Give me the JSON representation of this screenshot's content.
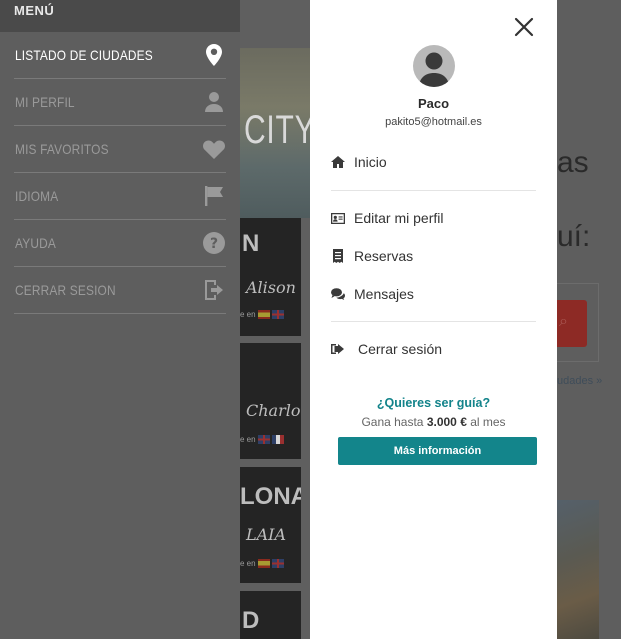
{
  "side_menu": {
    "header": "MENÚ",
    "items": [
      {
        "label": "LISTADO DE CIUDADES",
        "icon": "location-pin-icon",
        "active": true
      },
      {
        "label": "MI PERFIL",
        "icon": "user-icon",
        "active": false
      },
      {
        "label": "MIS FAVORITOS",
        "icon": "heart-icon",
        "active": false
      },
      {
        "label": "IDIOMA",
        "icon": "flag-icon",
        "active": false
      },
      {
        "label": "AYUDA",
        "icon": "help-icon",
        "active": false
      },
      {
        "label": "CERRAR SESION",
        "icon": "logout-icon",
        "active": false
      }
    ]
  },
  "background": {
    "hero_text": "CITY.",
    "cards": [
      {
        "big": "N",
        "script": "Alison",
        "lang_label": "e en"
      },
      {
        "big": "",
        "script": "Charlotte",
        "lang_label": "e en"
      },
      {
        "big": "LONA",
        "script": "LAIA",
        "lang_label": "e en"
      },
      {
        "big": "D",
        "script": "",
        "lang_label": ""
      }
    ],
    "right_texts": [
      "as",
      "uí:"
    ],
    "right_link": "udades »"
  },
  "drawer": {
    "close_icon": "close-icon",
    "user": {
      "name": "Paco",
      "email": "pakito5@hotmail.es",
      "avatar": "avatar-icon"
    },
    "nav_primary": [
      {
        "label": "Inicio",
        "icon": "home-icon"
      }
    ],
    "nav_secondary": [
      {
        "label": "Editar mi perfil",
        "icon": "id-card-icon"
      },
      {
        "label": "Reservas",
        "icon": "receipt-icon"
      },
      {
        "label": "Mensajes",
        "icon": "chat-icon"
      }
    ],
    "nav_logout": {
      "label": "Cerrar sesión",
      "icon": "sign-out-icon"
    },
    "guide": {
      "title": "¿Quieres ser guía?",
      "sub_prefix": "Gana hasta ",
      "sub_amount": "3.000 €",
      "sub_suffix": " al mes",
      "button": "Más información"
    }
  },
  "colors": {
    "accent": "#13858b",
    "accent_text": "#12838a",
    "menu_bg": "#5e5e5e"
  }
}
